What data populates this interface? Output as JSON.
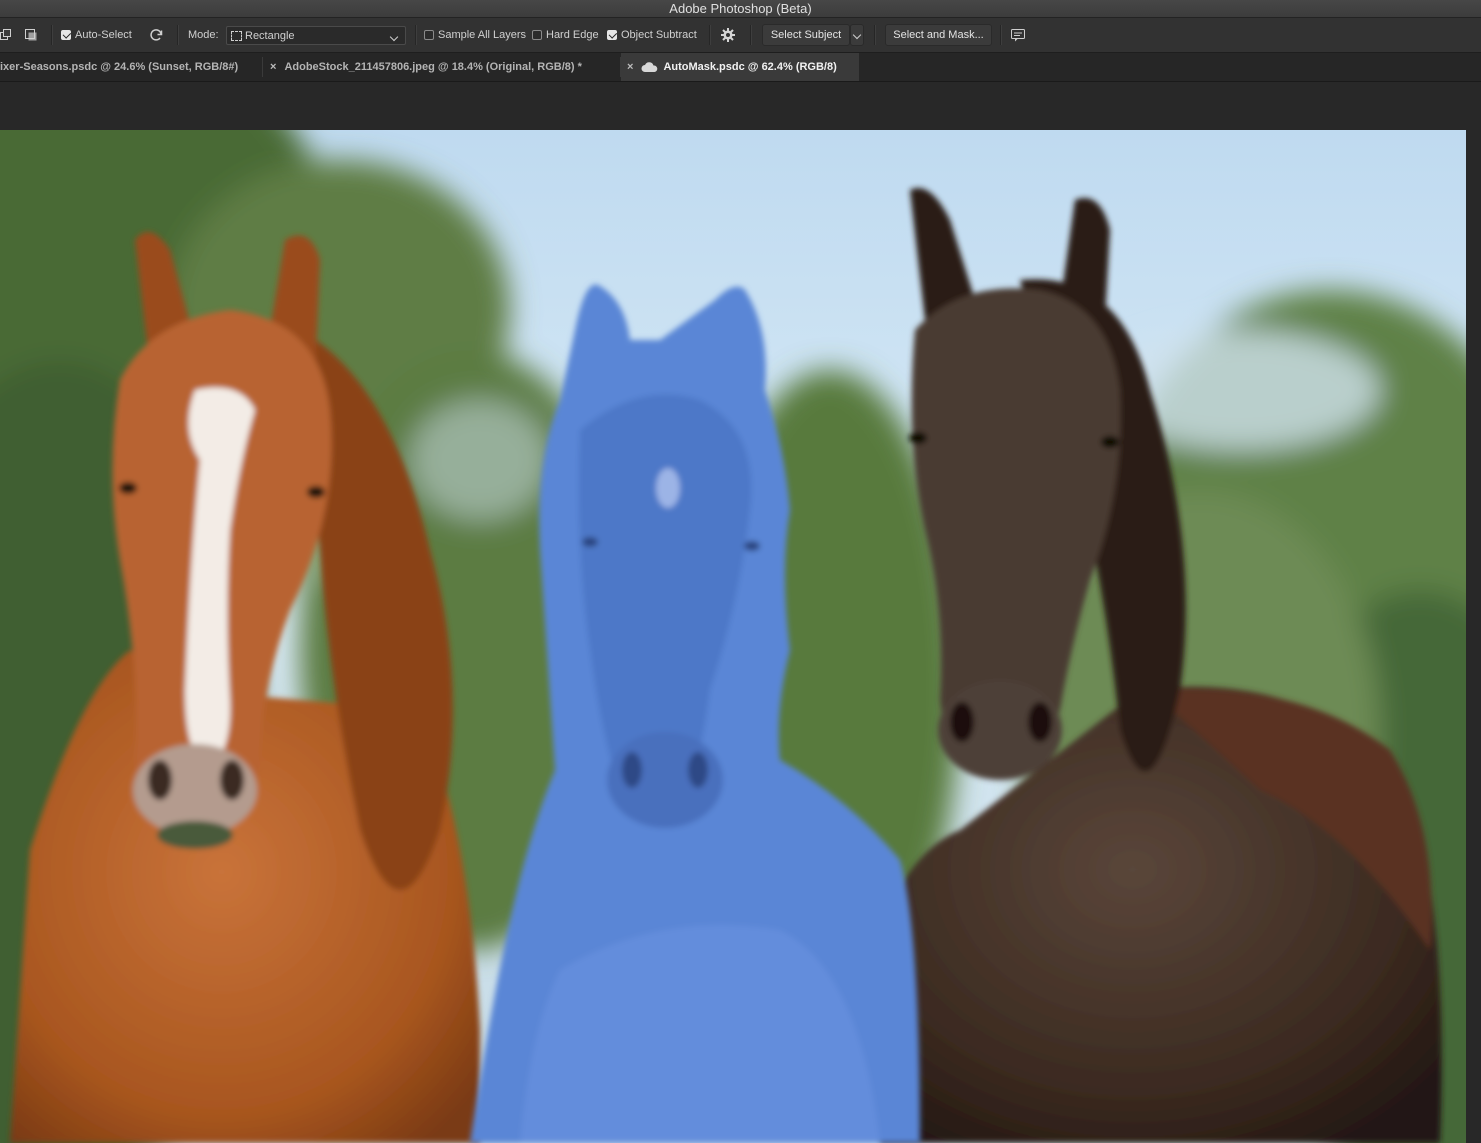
{
  "window": {
    "title": "Adobe Photoshop (Beta)"
  },
  "options_bar": {
    "auto_select": {
      "label": "Auto-Select",
      "checked": true
    },
    "mode": {
      "label": "Mode:",
      "value": "Rectangle"
    },
    "sample_all_layers": {
      "label": "Sample All Layers",
      "checked": false
    },
    "hard_edge": {
      "label": "Hard Edge",
      "checked": false
    },
    "object_subtract": {
      "label": "Object Subtract",
      "checked": true
    },
    "select_subject": "Select Subject",
    "select_and_mask": "Select and Mask..."
  },
  "tabs": [
    {
      "label": "ixer-Seasons.psdc @ 24.6% (Sunset, RGB/8#)",
      "active": false
    },
    {
      "label": "AdobeStock_211457806.jpeg @ 18.4% (Original, RGB/8) *",
      "active": false
    },
    {
      "label": "AutoMask.psdc @ 62.4% (RGB/8)",
      "active": true,
      "cloud": true
    }
  ],
  "colors": {
    "selection_overlay": "#5a86d6",
    "chestnut_horse": "#b55f2a",
    "dark_horse": "#3d2c22",
    "sky": "#c9e2f3",
    "foliage": "#4f6e3a"
  }
}
